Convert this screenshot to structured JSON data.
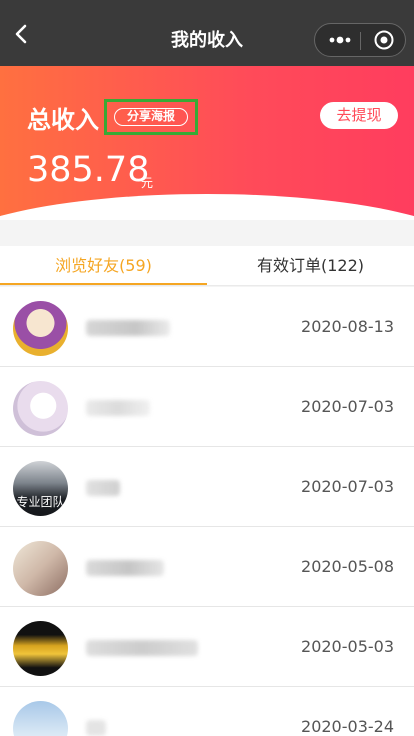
{
  "nav": {
    "title": "我的收入",
    "back_icon": "chevron-left-icon",
    "more_icon": "more-dots-icon",
    "close_icon": "record-circle-icon"
  },
  "header": {
    "total_label": "总收入",
    "share_label": "分享海报",
    "withdraw_label": "去提现",
    "amount": "385.78",
    "amount_unit": "元",
    "gradient_start": "#ff7040",
    "gradient_end": "#ff3d5e",
    "highlight_color": "#3aa935"
  },
  "tabs": [
    {
      "label": "浏览好友(59)",
      "active": true
    },
    {
      "label": "有效订单(122)",
      "active": false
    }
  ],
  "accent_color": "#f5a623",
  "friends": [
    {
      "date": "2020-08-13",
      "avatar_text": ""
    },
    {
      "date": "2020-07-03",
      "avatar_text": ""
    },
    {
      "date": "2020-07-03",
      "avatar_text": "专业团队"
    },
    {
      "date": "2020-05-08",
      "avatar_text": ""
    },
    {
      "date": "2020-05-03",
      "avatar_text": ""
    },
    {
      "date": "2020-03-24",
      "avatar_text": ""
    }
  ]
}
